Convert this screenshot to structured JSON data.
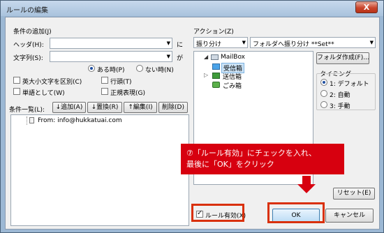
{
  "window": {
    "title": "ルールの編集",
    "close_symbol": "X"
  },
  "conditions": {
    "section_label": "条件の追加(J)",
    "header_label": "ヘッダ(H):",
    "header_value": "",
    "header_suffix": "に",
    "string_label": "文字列(S):",
    "string_value": "",
    "string_suffix": "が",
    "radio_present": "ある時(P)",
    "radio_absent": "ない時(N)",
    "check_case": "英大小文字を区別(C)",
    "check_line": "行頭(T)",
    "check_word": "単語として(W)",
    "check_regex": "正規表現(G)"
  },
  "list": {
    "label": "条件一覧(L):",
    "buttons": {
      "add": "↓追加(A)",
      "replace": "↓置換(R)",
      "edit": "↑編集(I)",
      "delete": "削除(D)"
    },
    "items": [
      "From: info@hukkatuai.com"
    ]
  },
  "action": {
    "label": "アクション(Z)",
    "type_value": "振り分け",
    "folder_value": "フォルダへ振り分け **Set**",
    "tree": {
      "root": "MailBox",
      "children": [
        {
          "label": "受信箱",
          "selected": true
        },
        {
          "label": "送信箱",
          "selected": false
        },
        {
          "label": "ごみ箱",
          "selected": false
        }
      ]
    },
    "create_folder": "フォルダ作成(F)...",
    "timing": {
      "label": "タイミング",
      "options": [
        "1: デフォルト",
        "2: 自動",
        "3: 手動"
      ],
      "selected_index": 0
    }
  },
  "footer": {
    "reset": "リセット(E)",
    "rule_enabled": "ルール有効(X)",
    "rule_enabled_checked": true,
    "ok": "OK",
    "cancel": "キャンセル"
  },
  "annotation": {
    "line1": "⑦「ルール有効」にチェックを入れ、",
    "line2": "最後に「OK」をクリック",
    "color": "#d7000f"
  }
}
